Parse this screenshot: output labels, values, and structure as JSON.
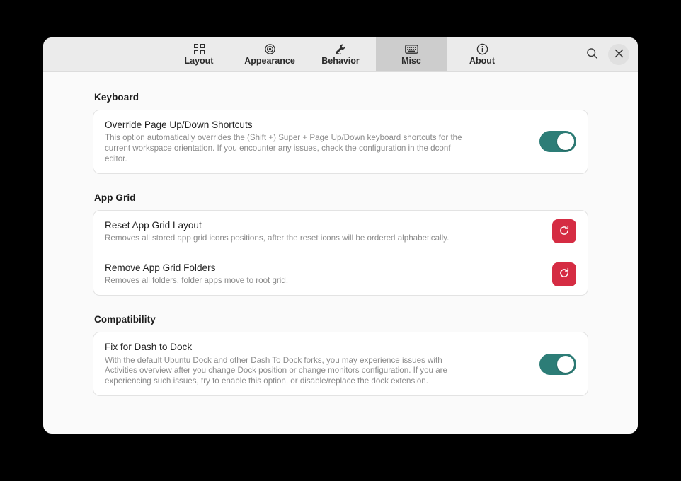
{
  "window": {
    "tabs": [
      {
        "label": "Layout",
        "icon": "grid-icon",
        "active": false
      },
      {
        "label": "Appearance",
        "icon": "eye-icon",
        "active": false
      },
      {
        "label": "Behavior",
        "icon": "wrench-icon",
        "active": false
      },
      {
        "label": "Misc",
        "icon": "keyboard-icon",
        "active": true
      },
      {
        "label": "About",
        "icon": "info-icon",
        "active": false
      }
    ],
    "actions": {
      "search_icon": "search-icon",
      "close_icon": "close-icon"
    }
  },
  "sections": [
    {
      "title": "Keyboard",
      "rows": [
        {
          "title": "Override Page Up/Down Shortcuts",
          "desc": "This option automatically overrides the (Shift +) Super + Page Up/Down keyboard shortcuts for the current workspace orientation. If you encounter any issues, check the configuration in the dconf editor.",
          "control": "toggle",
          "state": "on"
        }
      ]
    },
    {
      "title": "App Grid",
      "rows": [
        {
          "title": "Reset App Grid Layout",
          "desc": "Removes all stored app grid icons positions, after the reset icons will be ordered alphabetically.",
          "control": "reset",
          "state": ""
        },
        {
          "title": "Remove App Grid Folders",
          "desc": "Removes all folders, folder apps move to root grid.",
          "control": "reset",
          "state": ""
        }
      ]
    },
    {
      "title": "Compatibility",
      "rows": [
        {
          "title": "Fix for Dash to Dock",
          "desc": "With the default Ubuntu Dock and other Dash To Dock forks, you may experience issues with Activities overview after you change Dock position or change monitors configuration. If you are experiencing such issues, try to enable this option, or disable/replace the dock extension.",
          "control": "toggle",
          "state": "on"
        }
      ]
    }
  ],
  "colors": {
    "accent_toggle": "#2d7d77",
    "destructive": "#d52c43",
    "headerbar": "#ebebeb",
    "active_tab": "#cdcdcd",
    "content_bg": "#fafafa"
  }
}
